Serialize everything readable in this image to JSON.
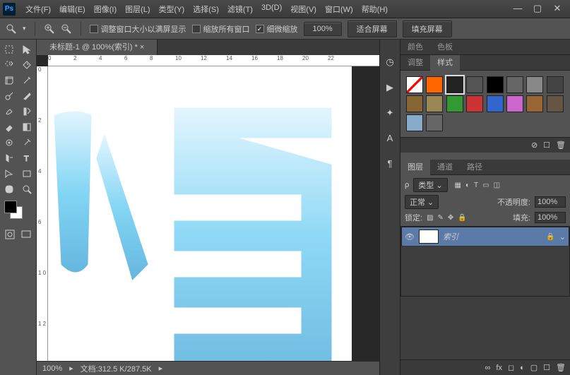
{
  "menu": {
    "items": [
      "文件(F)",
      "编辑(E)",
      "图像(I)",
      "图层(L)",
      "类型(Y)",
      "选择(S)",
      "滤镜(T)",
      "3D(D)",
      "视图(V)",
      "窗口(W)",
      "帮助(H)"
    ]
  },
  "window": {
    "min": "—",
    "max": "▢",
    "close": "✕"
  },
  "optbar": {
    "chk1": "调整窗口大小以满屏显示",
    "chk2": "缩放所有窗口",
    "chk3": "细微缩放",
    "zoom": "100%",
    "fit": "适合屏幕",
    "fill": "填充屏幕"
  },
  "doc": {
    "tab": "未标题-1 @ 100%(索引) * ×"
  },
  "ruler": {
    "h": [
      "0",
      "2",
      "4",
      "6",
      "8",
      "10",
      "12",
      "14",
      "16",
      "18",
      "20",
      "22"
    ],
    "v": [
      "0",
      "2",
      "4",
      "6",
      "1 0",
      "1 2"
    ]
  },
  "status": {
    "zoom": "100%",
    "doc": "文档:312.5 K/287.5K"
  },
  "midstrip": {
    "icons": [
      "◷",
      "▶",
      "✦",
      "A",
      "¶"
    ]
  },
  "panel_color": {
    "tabs": [
      "颜色",
      "色板"
    ],
    "tabs2": [
      "调整",
      "样式"
    ]
  },
  "styles_colors": [
    "#ffffff",
    "#ff6600",
    "#222222",
    "#555555",
    "#000000",
    "#666666",
    "#888888",
    "#444444",
    "#886633",
    "#998855",
    "#339933",
    "#cc3333",
    "#3366cc",
    "#cc66cc",
    "#996633",
    "#665544",
    "#88aacc",
    "#666666"
  ],
  "panel_layers": {
    "tabs": [
      "图层",
      "通道",
      "路径"
    ],
    "kind": "类型",
    "blend": "正常",
    "opacity_label": "不透明度:",
    "opacity": "100%",
    "lock_label": "锁定:",
    "fill_label": "填充:",
    "fill": "100%",
    "layer_name": "索引"
  }
}
